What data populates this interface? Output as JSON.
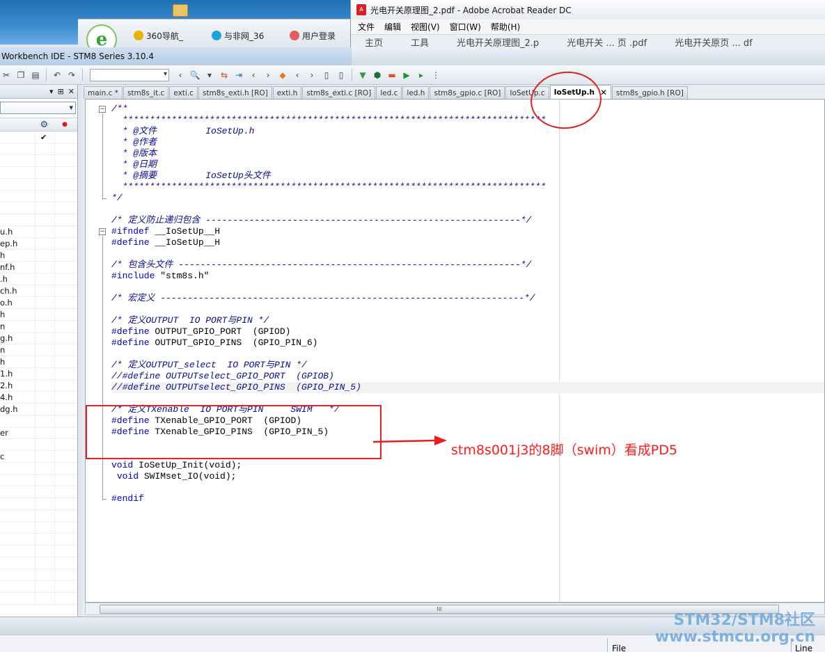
{
  "background": {
    "browser_tabs": [
      "360导航_",
      "与非网_36",
      "用户登录"
    ],
    "browser_logo": "e"
  },
  "acrobat": {
    "title": "光电开关原理图_2.pdf - Adobe Acrobat Reader DC",
    "menu": [
      "文件",
      "编辑",
      "视图(V)",
      "窗口(W)",
      "帮助(H)"
    ],
    "tabs": [
      "主页",
      "工具",
      "光电开关原理图_2.p",
      "光电开关 ... 页 .pdf",
      "光电开关原页 ... df"
    ]
  },
  "ide": {
    "title": "Workbench IDE - STM8 Series 3.10.4"
  },
  "workspace": {
    "header_buttons": [
      "▾",
      "⊞",
      "✕"
    ],
    "col_icons": {
      "settings": "⚙",
      "dot": "●"
    },
    "checked_mark": "✔",
    "items": [
      "u.h",
      "ep.h",
      "h",
      "nf.h",
      ".h",
      "ch.h",
      "o.h",
      "h",
      "n",
      "g.h",
      "n",
      "h",
      "1.h",
      "2.h",
      "4.h",
      "dg.h",
      "",
      "er",
      "",
      "c"
    ]
  },
  "tabs": [
    {
      "label": "main.c *"
    },
    {
      "label": "stm8s_it.c"
    },
    {
      "label": "exti.c"
    },
    {
      "label": "stm8s_exti.h [RO]"
    },
    {
      "label": "exti.h"
    },
    {
      "label": "stm8s_exti.c [RO]"
    },
    {
      "label": "led.c"
    },
    {
      "label": "led.h"
    },
    {
      "label": "stm8s_gpio.c [RO]"
    },
    {
      "label": "IoSetUp.c"
    },
    {
      "label": "IoSetUp.h",
      "active": true,
      "close": "✕"
    },
    {
      "label": "stm8s_gpio.h [RO]"
    }
  ],
  "code": [
    {
      "t": "c",
      "text": "/**"
    },
    {
      "t": "c",
      "text": "  ******************************************************************************"
    },
    {
      "t": "c",
      "text": "  * @文件         IoSetUp.h"
    },
    {
      "t": "c",
      "text": "  * @作者"
    },
    {
      "t": "c",
      "text": "  * @版本"
    },
    {
      "t": "c",
      "text": "  * @日期"
    },
    {
      "t": "c",
      "text": "  * @摘要         IoSetUp头文件"
    },
    {
      "t": "c",
      "text": "  ******************************************************************************"
    },
    {
      "t": "c",
      "text": "*/"
    },
    {
      "t": "n",
      "text": ""
    },
    {
      "t": "c",
      "text": "/* 定义防止递归包含 ----------------------------------------------------------*/"
    },
    {
      "t": "k",
      "text": "#ifndef __IoSetUp__H"
    },
    {
      "t": "k",
      "text": "#define __IoSetUp__H"
    },
    {
      "t": "n",
      "text": ""
    },
    {
      "t": "c",
      "text": "/* 包含头文件 ---------------------------------------------------------------*/"
    },
    {
      "t": "k",
      "text": "#include \"stm8s.h\""
    },
    {
      "t": "n",
      "text": ""
    },
    {
      "t": "c",
      "text": "/* 宏定义 -------------------------------------------------------------------*/"
    },
    {
      "t": "n",
      "text": ""
    },
    {
      "t": "c",
      "text": "/* 定义OUTPUT  IO PORT与PIN */"
    },
    {
      "t": "k",
      "text": "#define OUTPUT_GPIO_PORT  (GPIOD)"
    },
    {
      "t": "k",
      "text": "#define OUTPUT_GPIO_PINS  (GPIO_PIN_6)"
    },
    {
      "t": "n",
      "text": ""
    },
    {
      "t": "c",
      "text": "/* 定义OUTPUT_select  IO PORT与PIN */"
    },
    {
      "t": "c",
      "text": "//#define OUTPUTselect_GPIO_PORT  (GPIOB)"
    },
    {
      "t": "c",
      "text": "//#define OUTPUTselect_GPIO_PINS  (GPIO_PIN_5)",
      "hl": true
    },
    {
      "t": "n",
      "text": ""
    },
    {
      "t": "c",
      "text": "/* 定义TXenable  IO PORT与PIN     SWIM   */"
    },
    {
      "t": "k",
      "text": "#define TXenable_GPIO_PORT  (GPIOD)"
    },
    {
      "t": "k",
      "text": "#define TXenable_GPIO_PINS  (GPIO_PIN_5)"
    },
    {
      "t": "n",
      "text": ""
    },
    {
      "t": "n",
      "text": ""
    },
    {
      "t": "k",
      "text": "void IoSetUp_Init(void);"
    },
    {
      "t": "k",
      "text": " void SWIMset_IO(void);"
    },
    {
      "t": "n",
      "text": ""
    },
    {
      "t": "k",
      "text": "#endif"
    }
  ],
  "scroll": {
    "grip": "III"
  },
  "status": {
    "file": "File",
    "line": "Line"
  },
  "annotation": {
    "text": "stm8s001j3的8脚（swim）看成PD5",
    "color": "#ff1c1c"
  },
  "watermark": {
    "line1": "STM32/STM8社区",
    "line2": "www.stmcu.org.cn"
  }
}
